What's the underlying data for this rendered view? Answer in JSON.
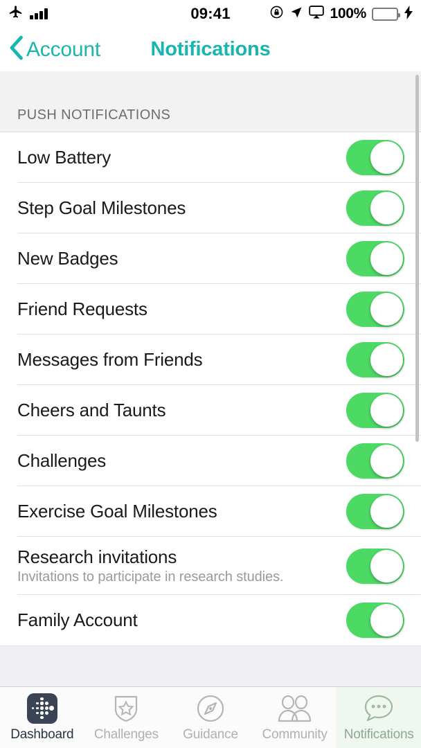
{
  "status_bar": {
    "airplane_icon": "airplane-icon",
    "signal_icon": "signal-bars-icon",
    "time": "09:41",
    "rotation_lock_icon": "rotation-lock-icon",
    "location_icon": "location-arrow-icon",
    "airplay_icon": "airplay-screen-icon",
    "battery_percent": "100%",
    "battery_level": 100,
    "charging_icon": "charging-bolt-icon"
  },
  "nav": {
    "back_icon": "chevron-left-icon",
    "back_label": "Account",
    "title": "Notifications",
    "accent_color": "#18b6ae"
  },
  "section": {
    "header": "PUSH NOTIFICATIONS",
    "switch_on_color": "#4cd964",
    "rows": [
      {
        "label": "Low Battery",
        "sub": "",
        "on": true
      },
      {
        "label": "Step Goal Milestones",
        "sub": "",
        "on": true
      },
      {
        "label": "New Badges",
        "sub": "",
        "on": true
      },
      {
        "label": "Friend Requests",
        "sub": "",
        "on": true
      },
      {
        "label": "Messages from Friends",
        "sub": "",
        "on": true
      },
      {
        "label": "Cheers and Taunts",
        "sub": "",
        "on": true
      },
      {
        "label": "Challenges",
        "sub": "",
        "on": true
      },
      {
        "label": "Exercise Goal Milestones",
        "sub": "",
        "on": true
      },
      {
        "label": "Research invitations",
        "sub": "Invitations to participate in research studies.",
        "on": true
      },
      {
        "label": "Family Account",
        "sub": "",
        "on": true
      }
    ]
  },
  "tab_bar": {
    "tabs": [
      {
        "label": "Dashboard",
        "icon": "fitbit-logo-icon",
        "active": true
      },
      {
        "label": "Challenges",
        "icon": "shield-star-icon",
        "active": false
      },
      {
        "label": "Guidance",
        "icon": "compass-icon",
        "active": false
      },
      {
        "label": "Community",
        "icon": "two-people-icon",
        "active": false
      },
      {
        "label": "Notifications",
        "icon": "speech-bubble-icon",
        "active": true
      }
    ]
  }
}
